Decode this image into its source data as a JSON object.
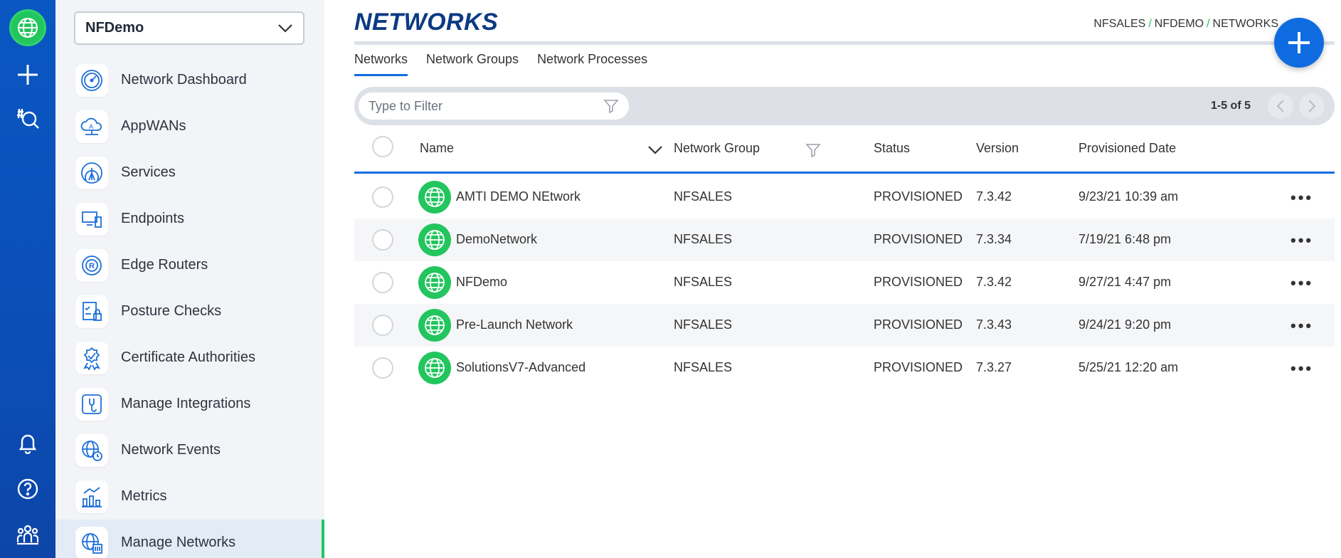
{
  "colors": {
    "rail": "#0b4eb8",
    "accent": "#0f6ce0",
    "brand_green": "#22c55e",
    "title": "#0c3a82"
  },
  "rail": {
    "top_icons": [
      "globe-logo-icon",
      "plus-icon",
      "hash-search-icon"
    ],
    "bottom_icons": [
      "bell-icon",
      "help-icon",
      "team-icon"
    ]
  },
  "sidebar": {
    "network_select": {
      "value": "NFDemo"
    },
    "items": [
      {
        "label": "Network Dashboard",
        "icon": "dashboard-gauge-icon"
      },
      {
        "label": "AppWANs",
        "icon": "appwan-cloud-icon"
      },
      {
        "label": "Services",
        "icon": "services-icon"
      },
      {
        "label": "Endpoints",
        "icon": "endpoints-icon"
      },
      {
        "label": "Edge Routers",
        "icon": "edge-router-icon"
      },
      {
        "label": "Posture Checks",
        "icon": "posture-check-icon"
      },
      {
        "label": "Certificate Authorities",
        "icon": "certificate-icon"
      },
      {
        "label": "Manage Integrations",
        "icon": "integrations-icon"
      },
      {
        "label": "Network Events",
        "icon": "network-events-icon"
      },
      {
        "label": "Metrics",
        "icon": "metrics-chart-icon"
      },
      {
        "label": "Manage Networks",
        "icon": "manage-networks-icon",
        "active": true
      }
    ]
  },
  "header": {
    "title": "NETWORKS",
    "breadcrumb": [
      "NFSALES",
      "NFDEMO",
      "NETWORKS"
    ],
    "breadcrumb_sep": "/"
  },
  "tabs": [
    {
      "label": "Networks",
      "active": true
    },
    {
      "label": "Network Groups"
    },
    {
      "label": "Network Processes"
    }
  ],
  "toolbar": {
    "filter_placeholder": "Type to Filter",
    "pager_text": "1-5 of 5"
  },
  "table": {
    "columns": [
      "Name",
      "Network Group",
      "Status",
      "Version",
      "Provisioned Date"
    ],
    "rows": [
      {
        "name": "AMTI DEMO NEtwork",
        "group": "NFSALES",
        "status": "PROVISIONED",
        "version": "7.3.42",
        "date": "9/23/21 10:39 am"
      },
      {
        "name": "DemoNetwork",
        "group": "NFSALES",
        "status": "PROVISIONED",
        "version": "7.3.34",
        "date": "7/19/21 6:48 pm"
      },
      {
        "name": "NFDemo",
        "group": "NFSALES",
        "status": "PROVISIONED",
        "version": "7.3.42",
        "date": "9/27/21 4:47 pm"
      },
      {
        "name": "Pre-Launch Network",
        "group": "NFSALES",
        "status": "PROVISIONED",
        "version": "7.3.43",
        "date": "9/24/21 9:20 pm"
      },
      {
        "name": "SolutionsV7-Advanced",
        "group": "NFSALES",
        "status": "PROVISIONED",
        "version": "7.3.27",
        "date": "5/25/21 12:20 am"
      }
    ],
    "row_menu": "•••"
  }
}
